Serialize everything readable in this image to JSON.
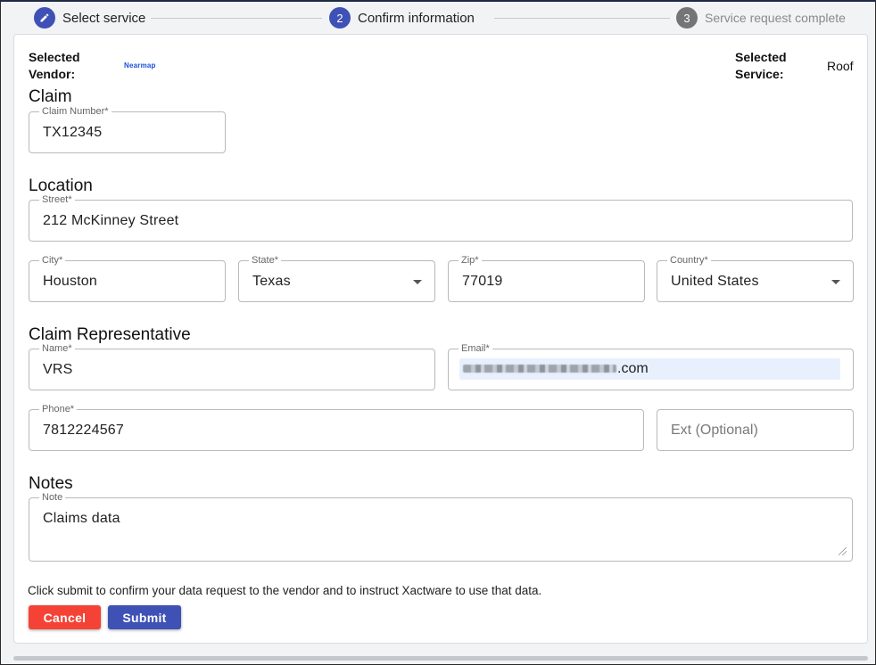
{
  "stepper": {
    "steps": [
      {
        "number": "",
        "label": "Select service",
        "icon": "pencil-icon",
        "state": "completed"
      },
      {
        "number": "2",
        "label": "Confirm information",
        "state": "active"
      },
      {
        "number": "3",
        "label": "Service request complete",
        "state": "inactive"
      }
    ]
  },
  "meta": {
    "vendor_label_1": "Selected",
    "vendor_label_2": "Vendor:",
    "vendor_value": "Nearmap",
    "service_label_1": "Selected",
    "service_label_2": "Service:",
    "service_value": "Roof"
  },
  "claim": {
    "title": "Claim",
    "number_label": "Claim Number*",
    "number_value": "TX12345"
  },
  "location": {
    "title": "Location",
    "street_label": "Street*",
    "street_value": "212 McKinney Street",
    "city_label": "City*",
    "city_value": "Houston",
    "state_label": "State*",
    "state_value": "Texas",
    "zip_label": "Zip*",
    "zip_value": "77019",
    "country_label": "Country*",
    "country_value": "United States"
  },
  "representative": {
    "title": "Claim Representative",
    "name_label": "Name*",
    "name_value": "VRS",
    "email_label": "Email*",
    "email_suffix": ".com",
    "phone_label": "Phone*",
    "phone_value": "7812224567",
    "ext_placeholder": "Ext (Optional)"
  },
  "notes": {
    "title": "Notes",
    "note_label": "Note",
    "note_value": "Claims data"
  },
  "footer": {
    "instruction": "Click submit to confirm your data request to the vendor and to instruct Xactware to use that data.",
    "cancel_label": "Cancel",
    "submit_label": "Submit"
  },
  "colors": {
    "primary": "#3f51b5",
    "danger": "#f44336",
    "autofill": "#e8f0fe"
  }
}
